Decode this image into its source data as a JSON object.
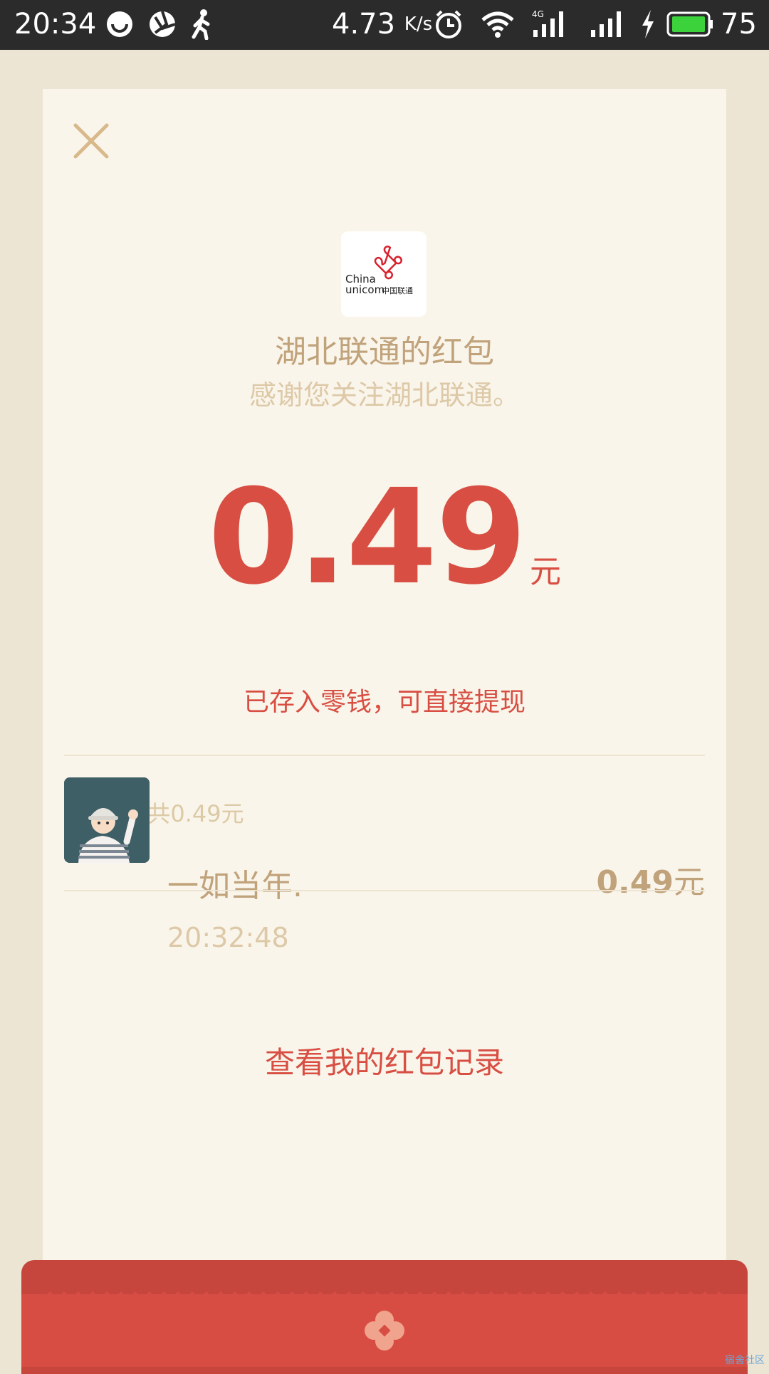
{
  "status_bar": {
    "time": "20:34",
    "speed_value": "4.73",
    "speed_unit": "K/s",
    "network_type": "4G",
    "battery_level": "75"
  },
  "card": {
    "sender_name": "湖北联通的红包",
    "greeting": "感谢您关注湖北联通。",
    "amount": "0.49",
    "amount_unit": "元",
    "stored_note": "已存入零钱，可直接提现",
    "summary": "1个红包共0.49元",
    "receiver": {
      "name": "一如当年.",
      "time": "20:32:48",
      "amount": "0.49",
      "amount_unit": "元"
    },
    "history_link": "查看我的红包记录"
  },
  "logo": {
    "line1": "China",
    "line2": "unicom",
    "cn_text": "中国联通"
  },
  "watermark": "宿舍社区",
  "colors": {
    "accent_red": "#d84e43",
    "gold_text": "#c0a27b",
    "light_gold_text": "#ddc9a8",
    "card_bg": "#faf5ea",
    "page_bg": "#ede5d3",
    "status_bar_bg": "#2b2b2b"
  },
  "icons": [
    "close-icon",
    "unicom-logo",
    "flower-icon",
    "wifi-icon",
    "alarm-icon",
    "battery-icon"
  ]
}
